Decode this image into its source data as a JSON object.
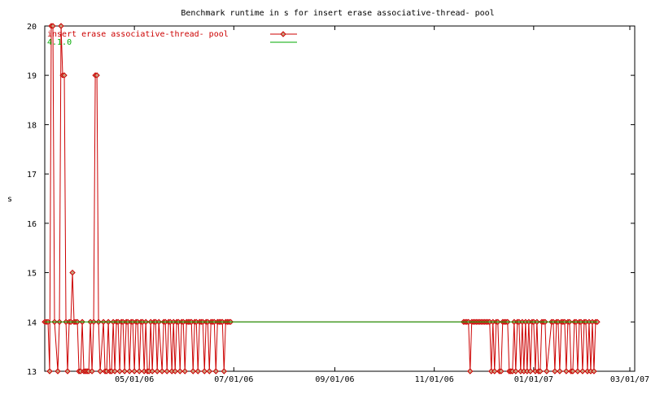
{
  "chart_data": {
    "type": "line",
    "title": "Benchmark runtime in s for insert erase associative-thread-  pool",
    "ylabel": "s",
    "xlabel": "",
    "ylim": [
      13,
      20
    ],
    "yticks": [
      13,
      14,
      15,
      16,
      17,
      18,
      19,
      20
    ],
    "xlim": [
      "2006-03-07",
      "2007-03-04"
    ],
    "xticks": [
      {
        "date": "2006-05-01",
        "label": "05/01/06"
      },
      {
        "date": "2006-07-01",
        "label": "07/01/06"
      },
      {
        "date": "2006-09-01",
        "label": "09/01/06"
      },
      {
        "date": "2006-11-01",
        "label": "11/01/06"
      },
      {
        "date": "2007-01-01",
        "label": "01/01/07"
      },
      {
        "date": "2007-03-01",
        "label": "03/01/07"
      }
    ],
    "legend_position": "top-left",
    "series": [
      {
        "name": "insert erase associative-thread-  pool",
        "color": "#cc0000",
        "marker": "diamond",
        "points": [
          [
            "2006-03-07",
            14
          ],
          [
            "2006-03-08",
            14
          ],
          [
            "2006-03-09",
            14
          ],
          [
            "2006-03-10",
            13
          ],
          [
            "2006-03-11",
            20
          ],
          [
            "2006-03-12",
            20
          ],
          [
            "2006-03-13",
            14
          ],
          [
            "2006-03-15",
            13
          ],
          [
            "2006-03-16",
            14
          ],
          [
            "2006-03-17",
            20
          ],
          [
            "2006-03-18",
            19
          ],
          [
            "2006-03-19",
            19
          ],
          [
            "2006-03-20",
            14
          ],
          [
            "2006-03-21",
            13
          ],
          [
            "2006-03-22",
            14
          ],
          [
            "2006-03-23",
            14
          ],
          [
            "2006-03-24",
            15
          ],
          [
            "2006-03-25",
            14
          ],
          [
            "2006-03-26",
            14
          ],
          [
            "2006-03-27",
            14
          ],
          [
            "2006-03-28",
            13
          ],
          [
            "2006-03-29",
            13
          ],
          [
            "2006-03-30",
            14
          ],
          [
            "2006-03-31",
            13
          ],
          [
            "2006-04-01",
            13
          ],
          [
            "2006-04-02",
            13
          ],
          [
            "2006-04-03",
            13
          ],
          [
            "2006-04-04",
            14
          ],
          [
            "2006-04-05",
            13
          ],
          [
            "2006-04-06",
            14
          ],
          [
            "2006-04-07",
            19
          ],
          [
            "2006-04-08",
            19
          ],
          [
            "2006-04-09",
            14
          ],
          [
            "2006-04-10",
            13
          ],
          [
            "2006-04-12",
            14
          ],
          [
            "2006-04-13",
            13
          ],
          [
            "2006-04-14",
            13
          ],
          [
            "2006-04-15",
            14
          ],
          [
            "2006-04-16",
            13
          ],
          [
            "2006-04-17",
            13
          ],
          [
            "2006-04-18",
            14
          ],
          [
            "2006-04-19",
            13
          ],
          [
            "2006-04-20",
            14
          ],
          [
            "2006-04-21",
            14
          ],
          [
            "2006-04-22",
            13
          ],
          [
            "2006-04-23",
            14
          ],
          [
            "2006-04-24",
            14
          ],
          [
            "2006-04-25",
            13
          ],
          [
            "2006-04-26",
            14
          ],
          [
            "2006-04-27",
            14
          ],
          [
            "2006-04-28",
            13
          ],
          [
            "2006-04-29",
            14
          ],
          [
            "2006-04-30",
            14
          ],
          [
            "2006-05-01",
            13
          ],
          [
            "2006-05-02",
            14
          ],
          [
            "2006-05-03",
            14
          ],
          [
            "2006-05-04",
            13
          ],
          [
            "2006-05-05",
            14
          ],
          [
            "2006-05-06",
            14
          ],
          [
            "2006-05-07",
            13
          ],
          [
            "2006-05-08",
            14
          ],
          [
            "2006-05-09",
            13
          ],
          [
            "2006-05-10",
            13
          ],
          [
            "2006-05-11",
            14
          ],
          [
            "2006-05-12",
            13
          ],
          [
            "2006-05-13",
            14
          ],
          [
            "2006-05-14",
            14
          ],
          [
            "2006-05-15",
            13
          ],
          [
            "2006-05-16",
            14
          ],
          [
            "2006-05-18",
            13
          ],
          [
            "2006-05-19",
            14
          ],
          [
            "2006-05-20",
            14
          ],
          [
            "2006-05-21",
            13
          ],
          [
            "2006-05-22",
            14
          ],
          [
            "2006-05-23",
            14
          ],
          [
            "2006-05-24",
            13
          ],
          [
            "2006-05-25",
            14
          ],
          [
            "2006-05-26",
            13
          ],
          [
            "2006-05-27",
            14
          ],
          [
            "2006-05-28",
            14
          ],
          [
            "2006-05-29",
            13
          ],
          [
            "2006-05-30",
            14
          ],
          [
            "2006-05-31",
            14
          ],
          [
            "2006-06-01",
            13
          ],
          [
            "2006-06-02",
            14
          ],
          [
            "2006-06-03",
            14
          ],
          [
            "2006-06-04",
            14
          ],
          [
            "2006-06-05",
            14
          ],
          [
            "2006-06-06",
            13
          ],
          [
            "2006-06-07",
            14
          ],
          [
            "2006-06-08",
            14
          ],
          [
            "2006-06-09",
            13
          ],
          [
            "2006-06-10",
            14
          ],
          [
            "2006-06-11",
            14
          ],
          [
            "2006-06-12",
            14
          ],
          [
            "2006-06-13",
            13
          ],
          [
            "2006-06-14",
            14
          ],
          [
            "2006-06-15",
            14
          ],
          [
            "2006-06-16",
            13
          ],
          [
            "2006-06-17",
            14
          ],
          [
            "2006-06-18",
            14
          ],
          [
            "2006-06-19",
            14
          ],
          [
            "2006-06-20",
            13
          ],
          [
            "2006-06-21",
            14
          ],
          [
            "2006-06-22",
            14
          ],
          [
            "2006-06-23",
            14
          ],
          [
            "2006-06-24",
            14
          ],
          [
            "2006-06-25",
            13
          ],
          [
            "2006-06-26",
            14
          ],
          [
            "2006-06-27",
            14
          ],
          [
            "2006-06-28",
            14
          ],
          [
            "2006-06-29",
            14
          ],
          [
            "2006-11-19",
            14
          ],
          [
            "2006-11-20",
            14
          ],
          [
            "2006-11-21",
            14
          ],
          [
            "2006-11-22",
            14
          ],
          [
            "2006-11-23",
            13
          ],
          [
            "2006-11-24",
            14
          ],
          [
            "2006-11-25",
            14
          ],
          [
            "2006-11-26",
            14
          ],
          [
            "2006-11-27",
            14
          ],
          [
            "2006-11-28",
            14
          ],
          [
            "2006-11-29",
            14
          ],
          [
            "2006-11-30",
            14
          ],
          [
            "2006-12-01",
            14
          ],
          [
            "2006-12-02",
            14
          ],
          [
            "2006-12-03",
            14
          ],
          [
            "2006-12-04",
            14
          ],
          [
            "2006-12-05",
            14
          ],
          [
            "2006-12-06",
            13
          ],
          [
            "2006-12-07",
            14
          ],
          [
            "2006-12-08",
            13
          ],
          [
            "2006-12-09",
            14
          ],
          [
            "2006-12-10",
            14
          ],
          [
            "2006-12-11",
            13
          ],
          [
            "2006-12-12",
            13
          ],
          [
            "2006-12-13",
            14
          ],
          [
            "2006-12-14",
            14
          ],
          [
            "2006-12-15",
            14
          ],
          [
            "2006-12-16",
            14
          ],
          [
            "2006-12-17",
            13
          ],
          [
            "2006-12-18",
            13
          ],
          [
            "2006-12-19",
            13
          ],
          [
            "2006-12-20",
            14
          ],
          [
            "2006-12-21",
            13
          ],
          [
            "2006-12-22",
            14
          ],
          [
            "2006-12-23",
            14
          ],
          [
            "2006-12-24",
            13
          ],
          [
            "2006-12-25",
            14
          ],
          [
            "2006-12-26",
            13
          ],
          [
            "2006-12-27",
            14
          ],
          [
            "2006-12-28",
            13
          ],
          [
            "2006-12-29",
            14
          ],
          [
            "2006-12-30",
            13
          ],
          [
            "2006-12-31",
            14
          ],
          [
            "2007-01-01",
            14
          ],
          [
            "2007-01-02",
            13
          ],
          [
            "2007-01-03",
            14
          ],
          [
            "2007-01-04",
            13
          ],
          [
            "2007-01-05",
            13
          ],
          [
            "2007-01-06",
            14
          ],
          [
            "2007-01-07",
            14
          ],
          [
            "2007-01-08",
            14
          ],
          [
            "2007-01-09",
            13
          ],
          [
            "2007-01-12",
            14
          ],
          [
            "2007-01-13",
            14
          ],
          [
            "2007-01-14",
            13
          ],
          [
            "2007-01-15",
            14
          ],
          [
            "2007-01-16",
            14
          ],
          [
            "2007-01-17",
            13
          ],
          [
            "2007-01-18",
            14
          ],
          [
            "2007-01-19",
            14
          ],
          [
            "2007-01-20",
            14
          ],
          [
            "2007-01-21",
            13
          ],
          [
            "2007-01-22",
            14
          ],
          [
            "2007-01-23",
            14
          ],
          [
            "2007-01-24",
            13
          ],
          [
            "2007-01-25",
            13
          ],
          [
            "2007-01-26",
            14
          ],
          [
            "2007-01-27",
            14
          ],
          [
            "2007-01-28",
            13
          ],
          [
            "2007-01-29",
            14
          ],
          [
            "2007-01-30",
            14
          ],
          [
            "2007-01-31",
            13
          ],
          [
            "2007-02-01",
            14
          ],
          [
            "2007-02-02",
            14
          ],
          [
            "2007-02-03",
            13
          ],
          [
            "2007-02-04",
            14
          ],
          [
            "2007-02-05",
            13
          ],
          [
            "2007-02-06",
            14
          ],
          [
            "2007-02-07",
            13
          ],
          [
            "2007-02-08",
            14
          ],
          [
            "2007-02-09",
            14
          ]
        ]
      },
      {
        "name": "4.1.0",
        "color": "#00aa00",
        "marker": "none",
        "points": [
          [
            "2006-03-07",
            14
          ],
          [
            "2007-02-09",
            14
          ]
        ]
      }
    ]
  }
}
